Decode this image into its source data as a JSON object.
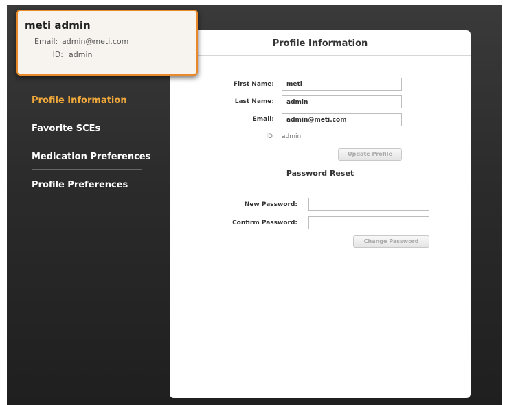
{
  "user": {
    "name": "meti admin",
    "email_label": "Email:",
    "email": "admin@meti.com",
    "id_label": "ID:",
    "id": "admin"
  },
  "nav": {
    "items": [
      {
        "label": "Profile Information",
        "active": true
      },
      {
        "label": "Favorite SCEs"
      },
      {
        "label": "Medication Preferences"
      },
      {
        "label": "Profile Preferences"
      }
    ]
  },
  "profile": {
    "title": "Profile Information",
    "first_name_label": "First Name:",
    "first_name": "meti",
    "last_name_label": "Last Name:",
    "last_name": "admin",
    "email_label": "Email:",
    "email": "admin@meti.com",
    "id_label": "ID",
    "id": "admin",
    "update_button": "Update Profile"
  },
  "password": {
    "title": "Password Reset",
    "new_label": "New Password:",
    "new_value": "",
    "confirm_label": "Confirm Password:",
    "confirm_value": "",
    "change_button": "Change Password"
  },
  "colors": {
    "accent": "#e8892b",
    "active_nav": "#f2a93b",
    "background": "#2b2b2b"
  }
}
